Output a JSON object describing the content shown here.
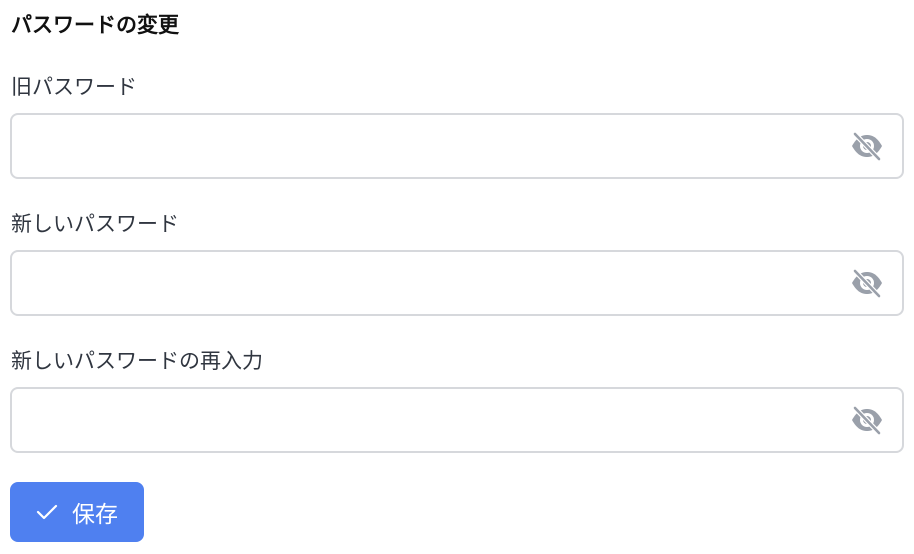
{
  "form": {
    "title": "パスワードの変更",
    "fields": [
      {
        "label": "旧パスワード",
        "value": "",
        "icon": "eye-off-icon"
      },
      {
        "label": "新しいパスワード",
        "value": "",
        "icon": "eye-off-icon"
      },
      {
        "label": "新しいパスワードの再入力",
        "value": "",
        "icon": "eye-off-icon"
      }
    ],
    "save_button": {
      "label": "保存",
      "icon": "check-icon"
    }
  },
  "colors": {
    "accent": "#4f80f0",
    "border": "#d6d8dc",
    "icon": "#9aa0aa"
  }
}
